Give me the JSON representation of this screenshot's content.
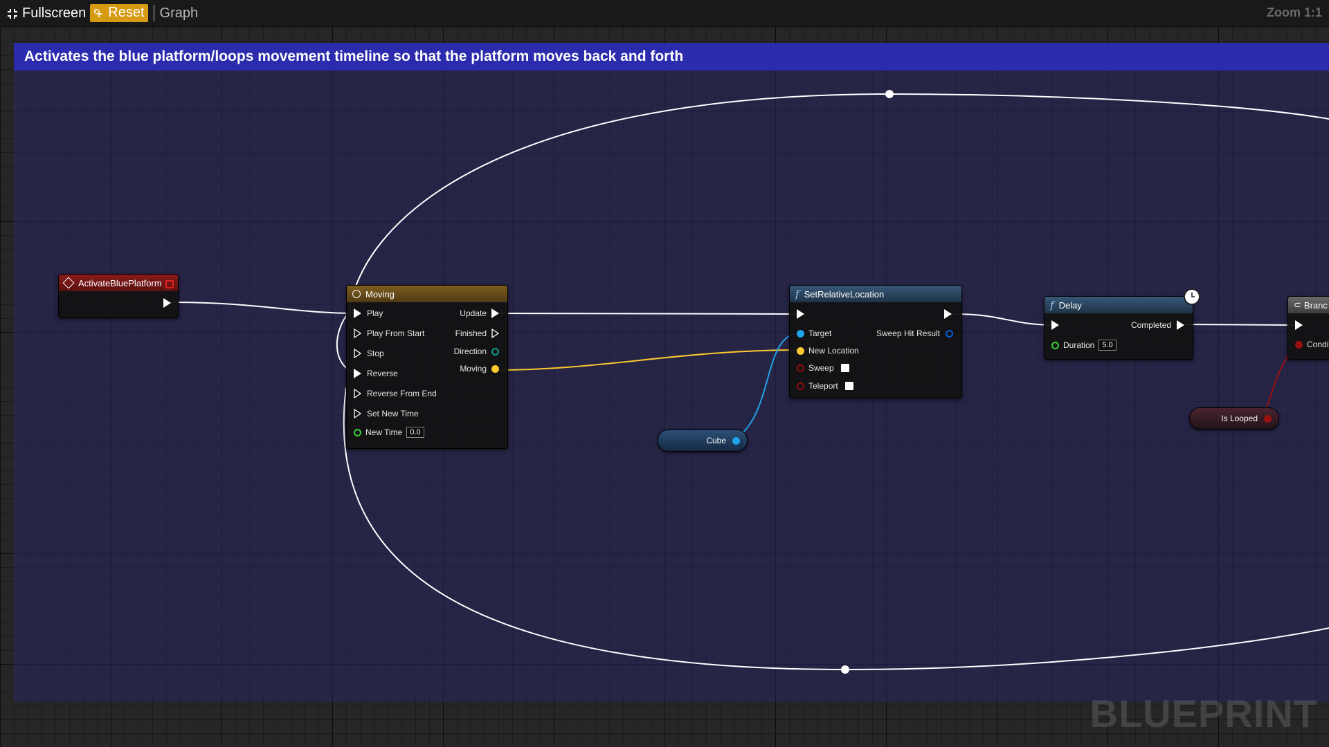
{
  "toolbar": {
    "fullscreen_label": "Fullscreen",
    "reset_label": "Reset",
    "graph_label": "Graph",
    "zoom_label": "Zoom 1:1"
  },
  "comment": {
    "text": "Activates the blue platform/loops movement timeline so that the platform moves back and forth"
  },
  "nodes": {
    "event": {
      "title": "ActivateBluePlatform",
      "color": "#7b1616"
    },
    "timeline": {
      "title": "Moving",
      "color": "#6e5119",
      "inputs": [
        "Play",
        "Play From Start",
        "Stop",
        "Reverse",
        "Reverse From End",
        "Set New Time"
      ],
      "new_time_label": "New Time",
      "new_time_value": "0.0",
      "outputs": {
        "update": "Update",
        "finished": "Finished",
        "direction": "Direction",
        "moving": "Moving"
      }
    },
    "set_relative_location": {
      "title": "SetRelativeLocation",
      "color": "#2d4a66",
      "target_label": "Target",
      "new_location_label": "New Location",
      "sweep_label": "Sweep",
      "teleport_label": "Teleport",
      "sweep_hit_result_label": "Sweep Hit Result"
    },
    "delay": {
      "title": "Delay",
      "color": "#2d4a66",
      "completed_label": "Completed",
      "duration_label": "Duration",
      "duration_value": "5.0"
    },
    "branch": {
      "title": "Branc",
      "condition_label": "Condi",
      "color": "#555"
    },
    "cube": {
      "label": "Cube"
    },
    "is_looped": {
      "label": "Is Looped"
    }
  },
  "colors": {
    "exec_wire": "#ffffff",
    "vector_pin": "#fdc92e",
    "object_pin": "#1fa3e8",
    "bool_pin": "#8e0d0d",
    "float_pin": "#38d137",
    "direction_pin": "#0d9c8a"
  },
  "watermark": "BLUEPRINT"
}
